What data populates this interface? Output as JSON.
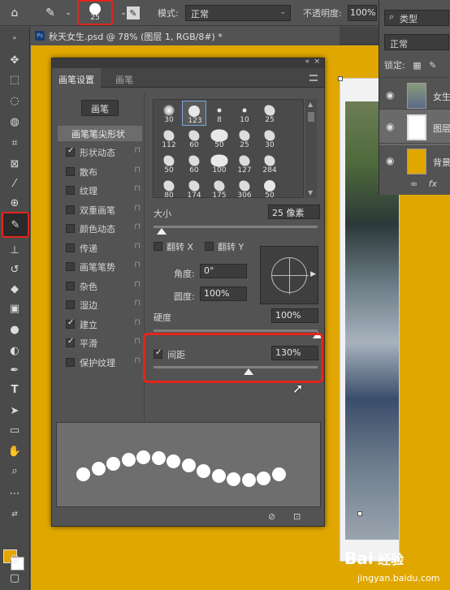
{
  "options_bar": {
    "brush_size": "25",
    "mode_label": "模式:",
    "mode_value": "正常",
    "opacity_label": "不透明度:",
    "opacity_value": "100%"
  },
  "document": {
    "ps_badge": "Ps",
    "tab_title": "秋天女生.psd @ 78% (图层 1, RGB/8#) *"
  },
  "layers_panel": {
    "search_label": "类型",
    "blend_mode": "正常",
    "lock_label": "锁定:",
    "layers": [
      {
        "name": "女生",
        "selected": false
      },
      {
        "name": "图层",
        "selected": true
      },
      {
        "name": "背景",
        "selected": false
      }
    ]
  },
  "brush_panel": {
    "tabs": [
      "画笔设置",
      "画笔"
    ],
    "presets_button": "画笔",
    "tip_shape_label": "画笔笔尖形状",
    "options": [
      {
        "label": "形状动态",
        "checked": true
      },
      {
        "label": "散布",
        "checked": false
      },
      {
        "label": "纹理",
        "checked": false
      },
      {
        "label": "双重画笔",
        "checked": false
      },
      {
        "label": "颜色动态",
        "checked": false
      },
      {
        "label": "传递",
        "checked": false
      },
      {
        "label": "画笔笔势",
        "checked": false
      },
      {
        "label": "杂色",
        "checked": false
      },
      {
        "label": "湿边",
        "checked": false
      },
      {
        "label": "建立",
        "checked": true
      },
      {
        "label": "平滑",
        "checked": true
      },
      {
        "label": "保护纹理",
        "checked": false
      }
    ],
    "tips": [
      {
        "num": "30",
        "kind": "soft"
      },
      {
        "num": "123",
        "kind": "hard"
      },
      {
        "num": "8",
        "kind": "hard"
      },
      {
        "num": "10",
        "kind": "hard"
      },
      {
        "num": "25",
        "kind": "splat"
      },
      {
        "num": "112",
        "kind": "splat"
      },
      {
        "num": "60",
        "kind": "splat"
      },
      {
        "num": "50",
        "kind": "blob"
      },
      {
        "num": "25",
        "kind": "splat"
      },
      {
        "num": "30",
        "kind": "splat"
      },
      {
        "num": "50",
        "kind": "splat"
      },
      {
        "num": "60",
        "kind": "splat"
      },
      {
        "num": "100",
        "kind": "blob"
      },
      {
        "num": "127",
        "kind": "splat"
      },
      {
        "num": "284",
        "kind": "splat"
      },
      {
        "num": "80",
        "kind": "splat"
      },
      {
        "num": "174",
        "kind": "splat"
      },
      {
        "num": "175",
        "kind": "splat"
      },
      {
        "num": "306",
        "kind": "splat"
      },
      {
        "num": "50",
        "kind": "hard"
      }
    ],
    "size_label": "大小",
    "size_value": "25 像素",
    "size_fraction": 0.05,
    "flip_x_label": "翻转 X",
    "flip_y_label": "翻转 Y",
    "angle_label": "角度:",
    "angle_value": "0°",
    "roundness_label": "圆度:",
    "roundness_value": "100%",
    "hardness_label": "硬度",
    "hardness_value": "100%",
    "hardness_fraction": 1.0,
    "spacing_label": "间距",
    "spacing_checked": true,
    "spacing_value": "130%",
    "spacing_fraction": 0.58
  },
  "watermark": {
    "brand": "Bai 经验",
    "url": "jingyan.baidu.com"
  },
  "colors": {
    "foreground": "#e6a500",
    "background": "#ffffff",
    "canvas": "#e0a700",
    "highlight": "#e1261c"
  }
}
